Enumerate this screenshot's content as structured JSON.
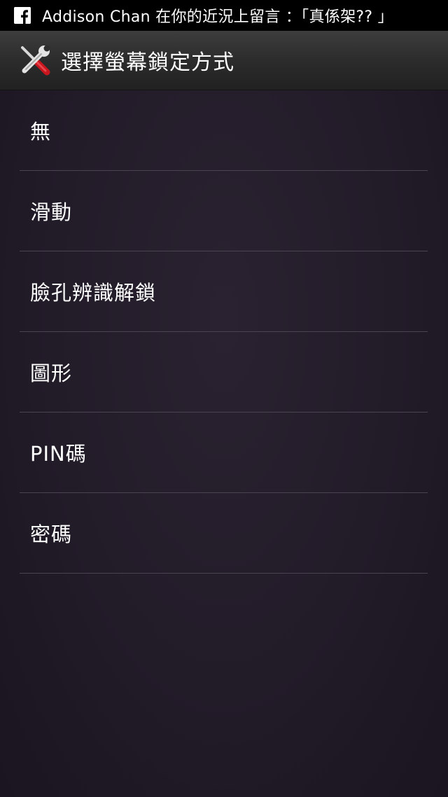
{
  "status_bar": {
    "notification_icon": "facebook-icon",
    "notification_text": "Addison Chan 在你的近況上留言 ：「真係架?? 」"
  },
  "header": {
    "icon": "wrench-screwdriver-icon",
    "title": "選擇螢幕鎖定方式"
  },
  "options": [
    {
      "label": "無"
    },
    {
      "label": "滑動"
    },
    {
      "label": "臉孔辨識解鎖"
    },
    {
      "label": "圖形"
    },
    {
      "label": "PIN碼"
    },
    {
      "label": "密碼"
    }
  ]
}
